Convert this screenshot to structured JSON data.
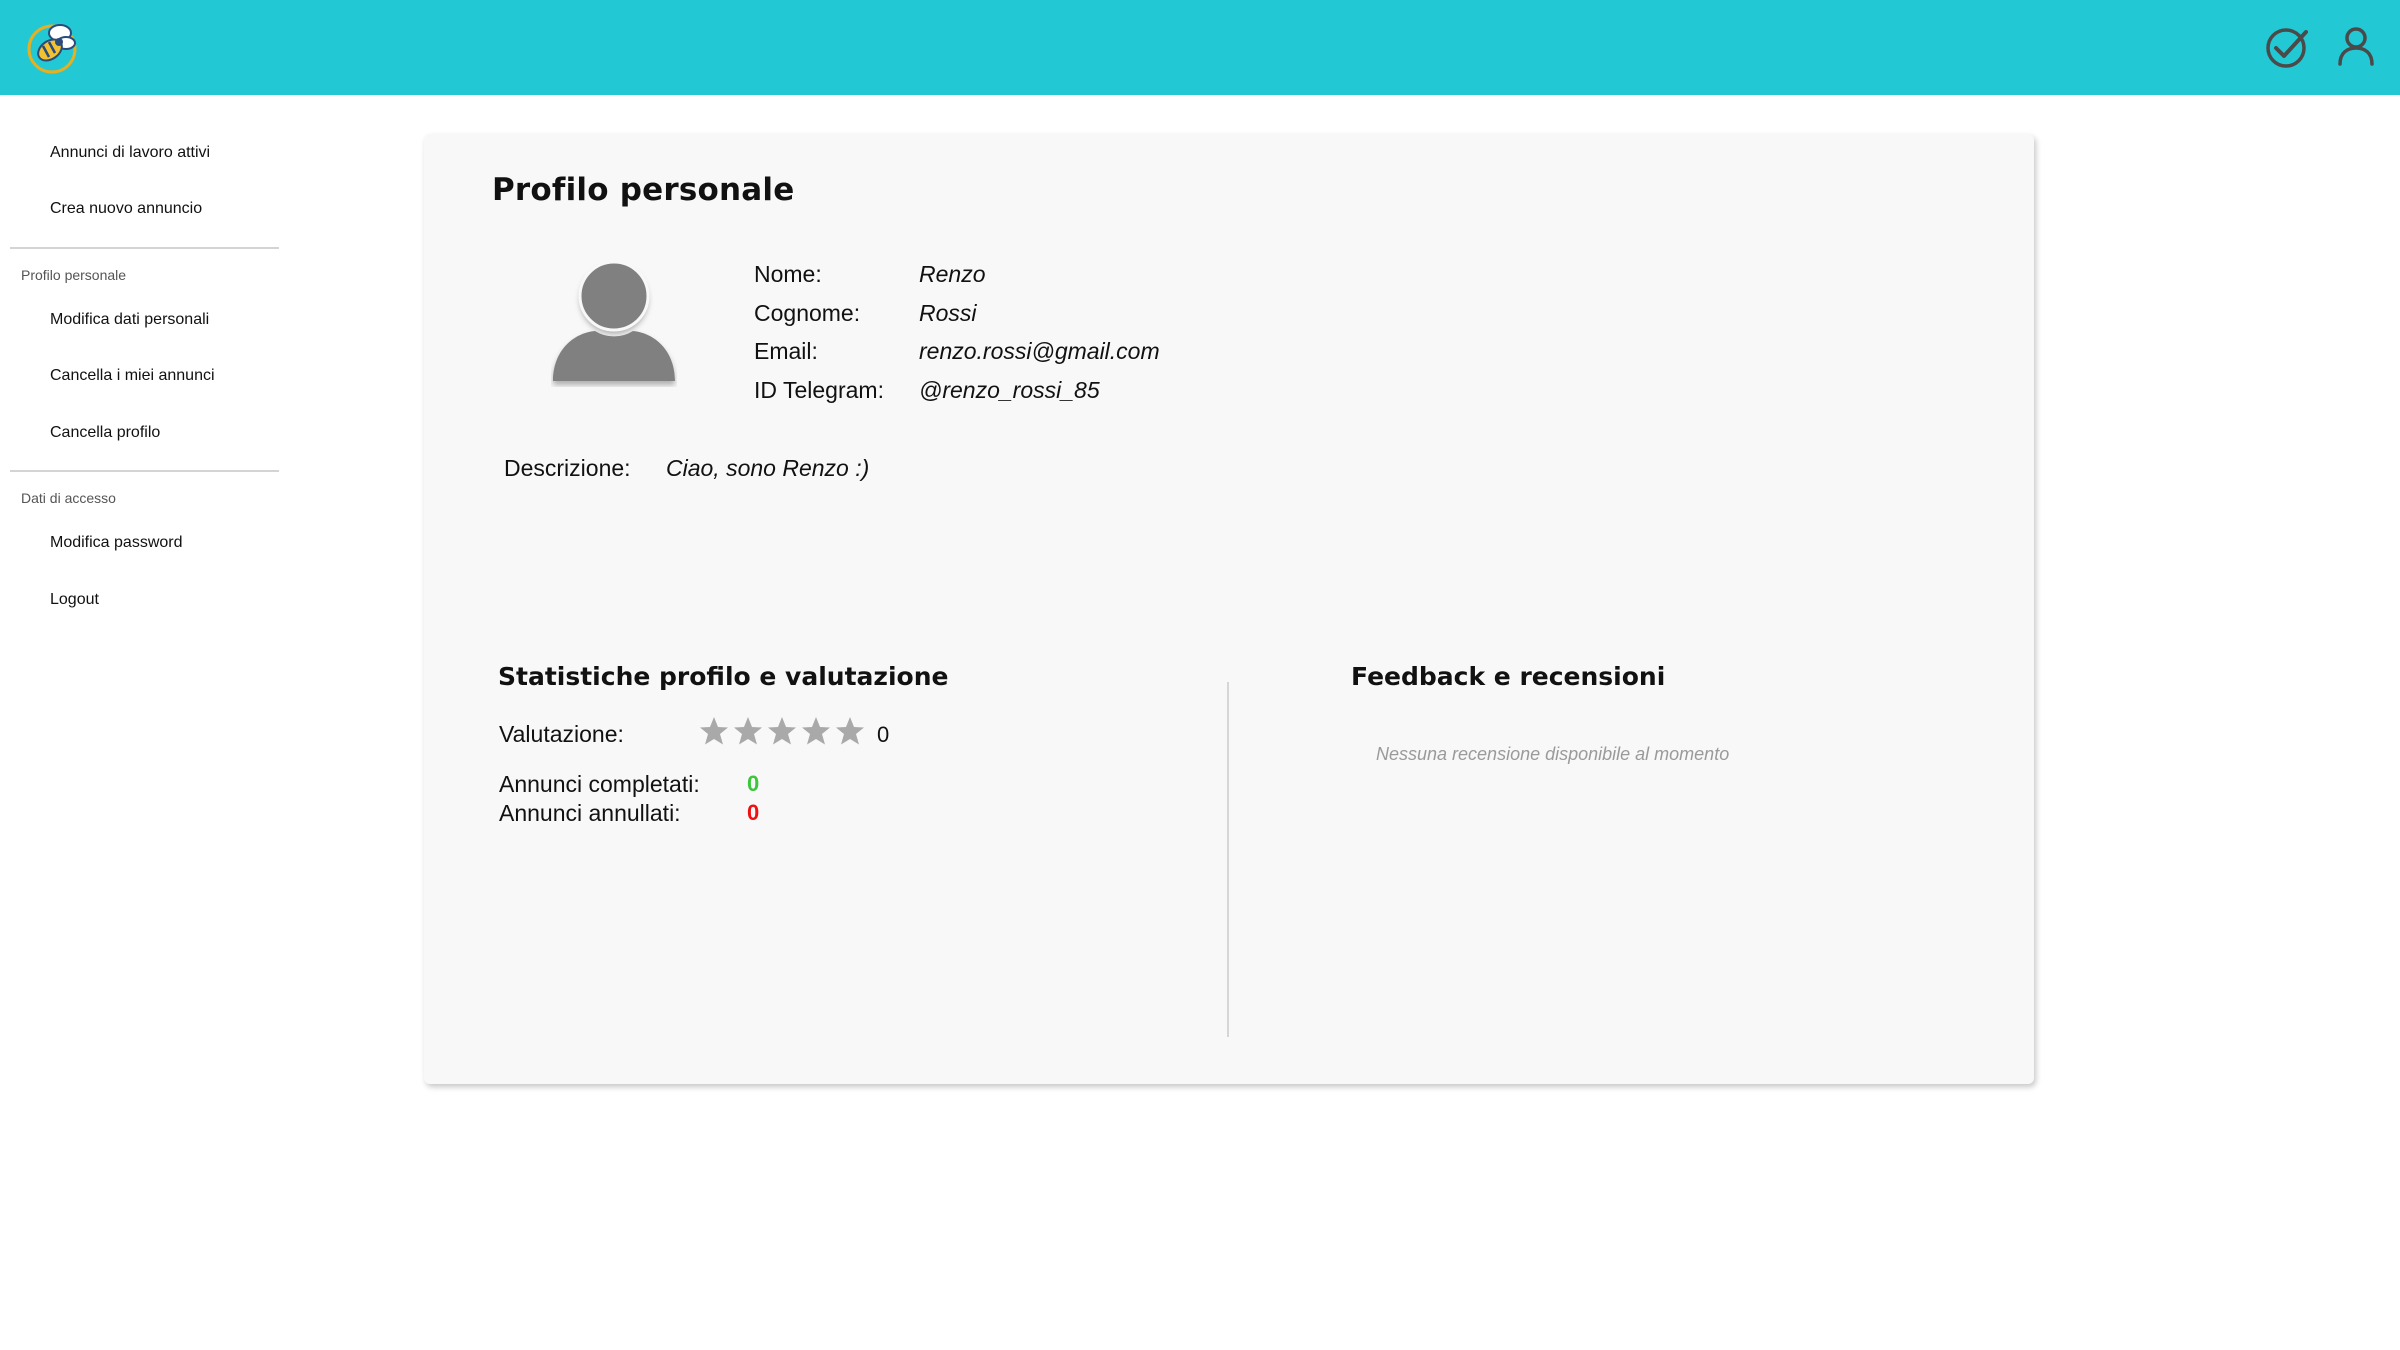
{
  "sidebar": {
    "items_top": [
      "Annunci di lavoro attivi",
      "Crea nuovo annuncio"
    ],
    "section_profile": {
      "heading": "Profilo personale",
      "items": [
        "Modifica dati personali",
        "Cancella i miei annunci",
        "Cancella profilo"
      ]
    },
    "section_access": {
      "heading": "Dati di accesso",
      "items": [
        "Modifica password",
        "Logout"
      ]
    }
  },
  "profile": {
    "title": "Profilo personale",
    "fields": [
      {
        "label": "Nome:",
        "value": "Renzo"
      },
      {
        "label": "Cognome:",
        "value": "Rossi"
      },
      {
        "label": "Email:",
        "value": "renzo.rossi@gmail.com"
      },
      {
        "label": "ID Telegram:",
        "value": "@renzo_rossi_85"
      }
    ],
    "description_label": "Descrizione:",
    "description_value": "Ciao, sono Renzo :)"
  },
  "stats": {
    "title": "Statistiche profilo e valutazione",
    "rating_label": "Valutazione:",
    "rating_value": "0",
    "rating_stars_filled": 0,
    "rating_stars_total": 5,
    "completed_label": "Annunci completati:",
    "completed_value": "0",
    "cancelled_label": "Annunci annullati:",
    "cancelled_value": "0"
  },
  "feedback": {
    "title": "Feedback e recensioni",
    "empty_text": "Nessuna recensione disponibile al momento"
  },
  "colors": {
    "topbar": "#22c9d4",
    "card_bg": "#f8f8f8",
    "completed": "#3cc63c",
    "cancelled": "#ee1111",
    "star": "#a9a9a9",
    "avatar": "#808080"
  },
  "icons": {
    "logo": "bee-logo-icon",
    "topbar_right": [
      "check-circle-icon",
      "user-icon"
    ]
  }
}
